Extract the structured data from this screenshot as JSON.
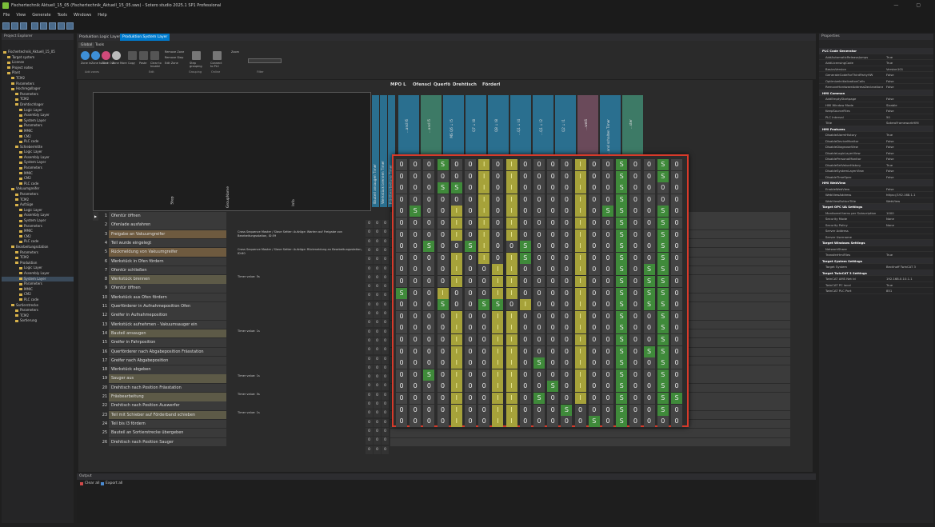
{
  "window": {
    "title": "Fischertechnik Aktuell_15_05 (Fischertechnik_Aktuell_15_05.sws) - Sotero studio 2025.1 SP1 Professional"
  },
  "menu": [
    "File",
    "View",
    "Generate",
    "Tools",
    "Windows",
    "Help"
  ],
  "project_explorer": {
    "title": "Project Explorer",
    "tree": [
      {
        "label": "Fischertechnik_Aktuell_15_05",
        "indent": 0
      },
      {
        "label": "Target system",
        "indent": 1
      },
      {
        "label": "License",
        "indent": 1
      },
      {
        "label": "Project notes",
        "indent": 1
      },
      {
        "label": "Plant",
        "indent": 1
      },
      {
        "label": "TCM2",
        "indent": 2
      },
      {
        "label": "Parameters",
        "indent": 2
      },
      {
        "label": "Hochregallager",
        "indent": 2
      },
      {
        "label": "Parameters",
        "indent": 3
      },
      {
        "label": "TCM2",
        "indent": 3
      },
      {
        "label": "Drehtischlager",
        "indent": 3
      },
      {
        "label": "Logic Layer",
        "indent": 4
      },
      {
        "label": "Assembly Layer",
        "indent": 4
      },
      {
        "label": "System Layer",
        "indent": 4
      },
      {
        "label": "Parameters",
        "indent": 4
      },
      {
        "label": "MMIC",
        "indent": 4
      },
      {
        "label": "CM2",
        "indent": 4
      },
      {
        "label": "PLC code",
        "indent": 4
      },
      {
        "label": "Schiebermitte",
        "indent": 3
      },
      {
        "label": "Logic Layer",
        "indent": 4
      },
      {
        "label": "Assembly Layer",
        "indent": 4
      },
      {
        "label": "System Layer",
        "indent": 4
      },
      {
        "label": "Parameters",
        "indent": 4
      },
      {
        "label": "MMIC",
        "indent": 4
      },
      {
        "label": "CM2",
        "indent": 4
      },
      {
        "label": "PLC code",
        "indent": 4
      },
      {
        "label": "Vakuumgreifer",
        "indent": 2
      },
      {
        "label": "Parameters",
        "indent": 3
      },
      {
        "label": "TCM2",
        "indent": 3
      },
      {
        "label": "Aufzüge",
        "indent": 3
      },
      {
        "label": "Logic Layer",
        "indent": 4
      },
      {
        "label": "Assembly Layer",
        "indent": 4
      },
      {
        "label": "System Layer",
        "indent": 4
      },
      {
        "label": "Parameters",
        "indent": 4
      },
      {
        "label": "MMIC",
        "indent": 4
      },
      {
        "label": "CM2",
        "indent": 4
      },
      {
        "label": "PLC code",
        "indent": 4
      },
      {
        "label": "Bearbeitungsstation",
        "indent": 2
      },
      {
        "label": "Parameters",
        "indent": 3
      },
      {
        "label": "TCM2",
        "indent": 3
      },
      {
        "label": "Produktion",
        "indent": 3
      },
      {
        "label": "Logic Layer",
        "indent": 4
      },
      {
        "label": "Assembly Layer",
        "indent": 4
      },
      {
        "label": "System Layer",
        "indent": 4
      },
      {
        "label": "Parameters",
        "indent": 4
      },
      {
        "label": "MMIC",
        "indent": 4
      },
      {
        "label": "CM2",
        "indent": 4
      },
      {
        "label": "PLC code",
        "indent": 4
      },
      {
        "label": "Sortierstrecke",
        "indent": 2
      },
      {
        "label": "Parameters",
        "indent": 3
      },
      {
        "label": "TCM2",
        "indent": 3
      },
      {
        "label": "Sortierung",
        "indent": 3
      }
    ]
  },
  "tabs": [
    "Produktion.Logic Layer",
    "Produktion.System Layer"
  ],
  "ribbon": {
    "tabs": [
      "Global",
      "Tools"
    ],
    "zone_buttons": [
      "Zone in",
      "Zone to Out",
      "Zone Out",
      "Zone More"
    ],
    "edit_buttons": [
      "Copy",
      "Paste",
      "Clear to Invalid",
      "Remove Zone",
      "Remove Step",
      "Edit Zone"
    ],
    "grouping": "Step grouping",
    "online": "Connect to PLC",
    "filter": "Zoom",
    "groups": [
      "Add zones",
      "Edit",
      "Grouping",
      "Online",
      "Filter"
    ]
  },
  "column_headers": [
    "MPO L",
    "Ofenscl",
    "Querfö",
    "Drehtisch",
    "Förderl"
  ],
  "grid_columns": {
    "step": "Step",
    "group": "GroupName",
    "info": "Info",
    "timers": [
      "Bauteil ansaugen Timer",
      "Werkstück brennen Timer",
      "Frästbearbeitung Timer"
    ],
    "top_labels": [
      "...and I6",
      "...and I5",
      "MS Q6 ↓ I5",
      "Q7 ↓ I8",
      "Q8 ↓ I8",
      "...Q1 ↓ I4",
      "...Q1 ↓ I2",
      "Q2 ↓ I1",
      "...weiß",
      "...and schalten Timer",
      "...ster"
    ]
  },
  "steps": [
    {
      "n": "1",
      "label": "Ofentür öffnen",
      "info": "",
      "style": ""
    },
    {
      "n": "2",
      "label": "Ofenlade ausfahren",
      "info": "",
      "style": ""
    },
    {
      "n": "3",
      "label": "Freigabe an Vakuumgreifer",
      "info": "Cross Sequence Master / Slave Setter: Aufzüge: Warten auf Freigabe von Bearbeitungsstation, ID:59",
      "style": "hl"
    },
    {
      "n": "4",
      "label": "Teil wurde eingelegt",
      "info": "",
      "style": ""
    },
    {
      "n": "5",
      "label": "Rückmeldung von Vakuumgreifer",
      "info": "Cross Sequence Master / Slave Setter: Aufzüge: Rückmeldung an Bearbeitungsstation, ID:60",
      "style": "hl"
    },
    {
      "n": "6",
      "label": "Werkstück in Ofen fördern",
      "info": "",
      "style": ""
    },
    {
      "n": "7",
      "label": "Ofentür schließen",
      "info": "",
      "style": ""
    },
    {
      "n": "8",
      "label": "Werkstück brennen",
      "info": "Timer value: 5s",
      "style": "hl2"
    },
    {
      "n": "9",
      "label": "Ofentür öffnen",
      "info": "",
      "style": ""
    },
    {
      "n": "10",
      "label": "Werkstück aus Ofen fördern",
      "info": "",
      "style": ""
    },
    {
      "n": "11",
      "label": "Querförderer in Aufnahmeposition Ofen",
      "info": "",
      "style": ""
    },
    {
      "n": "12",
      "label": "Greifer in Aufnahmeposition",
      "info": "",
      "style": ""
    },
    {
      "n": "13",
      "label": "Werkstück aufnehmen - Vakuumsauger ein",
      "info": "",
      "style": ""
    },
    {
      "n": "14",
      "label": "Bauteil ansaugen",
      "info": "Timer value: 1s",
      "style": "hl2"
    },
    {
      "n": "15",
      "label": "Greifer in Fahrposition",
      "info": "",
      "style": ""
    },
    {
      "n": "16",
      "label": "Querförderer nach Abgabeposition Frässtation",
      "info": "",
      "style": ""
    },
    {
      "n": "17",
      "label": "Greifer nach Abgabeposition",
      "info": "",
      "style": ""
    },
    {
      "n": "18",
      "label": "Werkstück abgeben",
      "info": "",
      "style": ""
    },
    {
      "n": "19",
      "label": "Sauger aus",
      "info": "Timer value: 1s",
      "style": "hl2"
    },
    {
      "n": "20",
      "label": "Drehtisch nach Position Frässtation",
      "info": "",
      "style": ""
    },
    {
      "n": "21",
      "label": "Fräsbearbeitung",
      "info": "Timer value: 5s",
      "style": "hl2"
    },
    {
      "n": "22",
      "label": "Drehtisch nach Position Auswerfer",
      "info": "",
      "style": ""
    },
    {
      "n": "23",
      "label": "Teil mit Schieber auf Förderband schieben",
      "info": "Timer value: 1s",
      "style": "hl2"
    },
    {
      "n": "24",
      "label": "Teil bis I3 fördern",
      "info": "",
      "style": ""
    },
    {
      "n": "25",
      "label": "Bauteil an Sortierstrecke übergeben",
      "info": "",
      "style": ""
    },
    {
      "n": "26",
      "label": "Drehtisch nach Position Sauger",
      "info": "",
      "style": ""
    }
  ],
  "zoom_matrix": [
    "0 0 0 S 0 0 I 0 I 0 0 0 0 I 0 0 S 0 0 S 0",
    "0 0 0 0 0 0 I 0 I 0 0 0 0 I 0 0 S 0 0 S 0",
    "0 0 0 S S 0 I 0 I 0 0 0 0 I 0 0 S 0 0 0 0",
    "0 0 0 0 0 0 I 0 I 0 0 0 0 I 0 0 S 0 0 0 0",
    "0 S 0 0 I 0 I 0 I 0 0 0 0 I 0 S S 0 0 S 0",
    "0 0 0 0 I 0 I 0 I 0 0 0 0 I 0 0 S 0 0 S 0",
    "0 0 0 0 I 0 I 0 I 0 0 0 0 I 0 0 S 0 0 S 0",
    "0 0 S 0 0 S I 0 0 S 0 0 0 I 0 0 S 0 0 S 0",
    "0 0 0 0 I 0 I 0 I S 0 0 0 I 0 0 S 0 0 S 0",
    "0 0 0 0 I 0 0 I I 0 0 0 0 I 0 0 S 0 S S 0",
    "0 0 0 0 I 0 0 I I 0 0 0 0 I 0 0 S 0 S S 0",
    "S 0 0 I 0 0 0 I I 0 0 0 0 I 0 0 S 0 S S 0",
    "0 0 0 S 0 0 S S 0 I 0 0 0 I 0 0 S 0 S S 0",
    "0 0 0 0 I 0 0 I I 0 0 0 0 I 0 0 S 0 0 S 0",
    "0 0 0 0 I 0 0 I I 0 0 0 0 I 0 0 S 0 0 S 0",
    "0 0 0 0 I 0 0 I I 0 0 0 0 I 0 0 S 0 0 S 0",
    "0 0 0 0 I 0 0 I I 0 0 0 0 I 0 0 S 0 S S 0",
    "0 0 0 0 I 0 0 I I 0 S 0 0 I 0 0 S 0 0 S 0",
    "0 0 S 0 I 0 0 I I 0 0 0 0 I 0 0 S 0 0 S 0",
    "0 0 0 0 I 0 0 I I 0 0 S 0 I 0 0 S 0 0 S 0",
    "0 0 0 0 I 0 0 I I 0 S 0 0 I 0 0 S 0 0 S S",
    "0 0 0 0 I 0 0 I I 0 0 0 S 0 0 0 S 0 0 S 0",
    "0 0 0 0 I 0 0 I I 0 0 0 0 0 S 0 S 0 0 0 0"
  ],
  "output": {
    "title": "Output",
    "clear": "Clear all",
    "export": "Export all"
  },
  "properties": {
    "title": "Properties",
    "rows": [
      {
        "k": "PLC Code Generator",
        "v": "",
        "cat": true
      },
      {
        "k": "AddAutomaticReleaseJumps",
        "v": "True"
      },
      {
        "k": "AddLicensingCode",
        "v": "True"
      },
      {
        "k": "BasicsVersion",
        "v": "Version101"
      },
      {
        "k": "GenerateCodeForThirdPartyHW",
        "v": "False"
      },
      {
        "k": "OptimizeInitializationCalls",
        "v": "False"
      },
      {
        "k": "RemoveHardwareAddressDeclarations",
        "v": "False"
      },
      {
        "k": "HMI Common",
        "v": "",
        "cat": true
      },
      {
        "k": "AddEmptyStartpage",
        "v": "False"
      },
      {
        "k": "HMI Window Mode",
        "v": "Sizable"
      },
      {
        "k": "KeepSourceFiles",
        "v": "False"
      },
      {
        "k": "PLC Interval",
        "v": "50"
      },
      {
        "k": "Title",
        "v": "SoteroFrameworkHMI"
      },
      {
        "k": "HMI Features",
        "v": "",
        "cat": true
      },
      {
        "k": "DisableAlarmHistory",
        "v": "True"
      },
      {
        "k": "DisableDeviceMonitor",
        "v": "False"
      },
      {
        "k": "DisableDiagnoseView",
        "v": "False"
      },
      {
        "k": "DisableLogicLayerView",
        "v": "False"
      },
      {
        "k": "DisablePersonalMonitor",
        "v": "False"
      },
      {
        "k": "DisableSetValueHistory",
        "v": "True"
      },
      {
        "k": "DisableSystemLayerView",
        "v": "False"
      },
      {
        "k": "DisableTimeSpec",
        "v": "False"
      },
      {
        "k": "HMI WebView",
        "v": "",
        "cat": true
      },
      {
        "k": "EnableWebView",
        "v": "False"
      },
      {
        "k": "WebViewAddress",
        "v": "https://192.168.1.1"
      },
      {
        "k": "WebViewButtonTitle",
        "v": "WebView"
      },
      {
        "k": "Target OPC UA Settings",
        "v": "",
        "cat": true
      },
      {
        "k": "Monitored Items per Subscription",
        "v": "1000"
      },
      {
        "k": "Security Mode",
        "v": "None"
      },
      {
        "k": "Security Policy",
        "v": "None"
      },
      {
        "k": "Server Address",
        "v": ""
      },
      {
        "k": "Server Username",
        "v": ""
      },
      {
        "k": "Target Windows Settings",
        "v": "",
        "cat": true
      },
      {
        "k": "NetworkShare",
        "v": ""
      },
      {
        "k": "TransferHmiFiles",
        "v": "True"
      },
      {
        "k": "Target System Settings",
        "v": "",
        "cat": true
      },
      {
        "k": "Target System",
        "v": "Beckhoff TwinCAT 3"
      },
      {
        "k": "Target TwinCAT 3 Settings",
        "v": "",
        "cat": true
      },
      {
        "k": "TwinCAT AMS Net Id",
        "v": "192.168.0.10.1.1"
      },
      {
        "k": "TwinCAT PC local",
        "v": "True"
      },
      {
        "k": "TwinCAT PLC Port",
        "v": "851"
      }
    ]
  },
  "colors": {
    "accent": "#007acc",
    "stepHighlight": "#6e5a3f",
    "cellS": "#3f8a3a",
    "cellI": "#a6a23a",
    "zoomBorder": "#d73a2a"
  }
}
